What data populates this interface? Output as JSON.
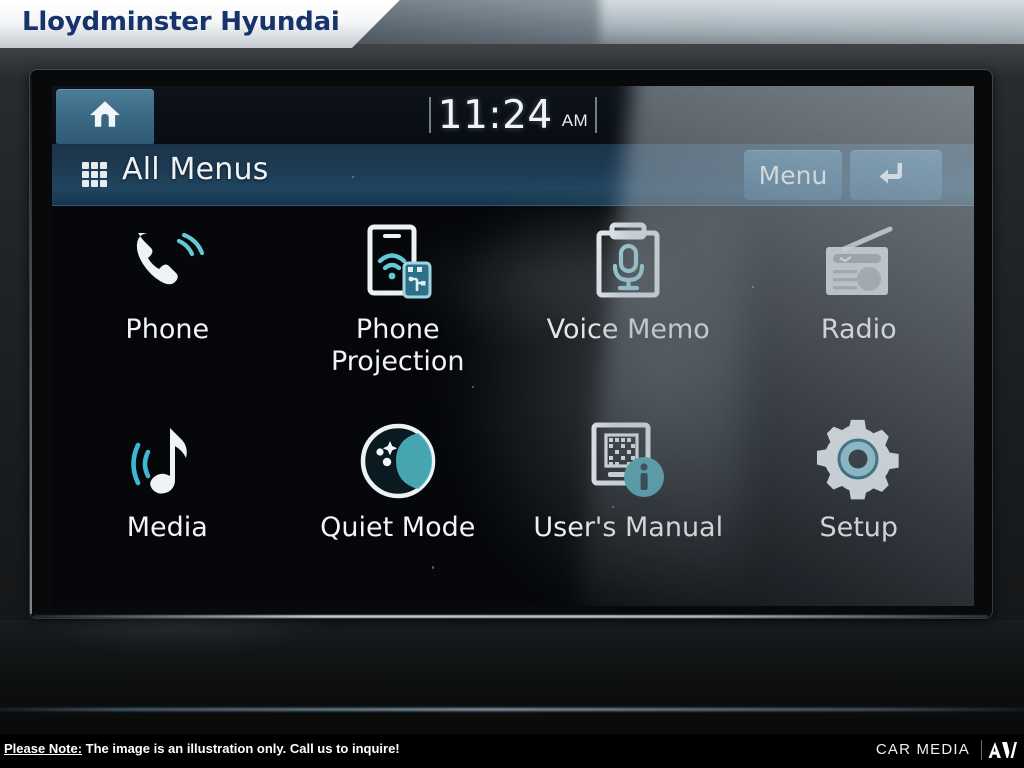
{
  "banner": {
    "dealer_name": "Lloydminster Hyundai"
  },
  "screen": {
    "statusbar": {
      "home_button": "home-icon",
      "clock_time": "11:24",
      "clock_period": "AM"
    },
    "titlebar": {
      "grid_icon": "grid-menu-icon",
      "title": "All Menus",
      "menu_button": "Menu",
      "back_button": "back-arrow-icon"
    },
    "apps": [
      {
        "label": "Phone",
        "icon": "phone-handset-icon"
      },
      {
        "label": "Phone\nProjection",
        "label_line1": "Phone",
        "label_line2": "Projection",
        "icon": "phone-projection-icon"
      },
      {
        "label": "Voice Memo",
        "icon": "voice-memo-icon"
      },
      {
        "label": "Radio",
        "icon": "radio-icon"
      },
      {
        "label": "Media",
        "icon": "music-note-icon"
      },
      {
        "label": "Quiet Mode",
        "icon": "crescent-moon-icon"
      },
      {
        "label": "User's Manual",
        "icon": "qr-manual-info-icon"
      },
      {
        "label": "Setup",
        "icon": "gear-icon"
      }
    ]
  },
  "footer": {
    "note_prefix": "Please Note:",
    "note_text": "The image is an illustration only. Call us to inquire!",
    "brand": "CAR MEDIA",
    "brand_mark": "av-logo-icon"
  },
  "colors": {
    "brand_blue": "#16336b",
    "accent_cyan": "#5fc3d6",
    "button_blue": "#35678a",
    "titlebar_blue": "#1d3b54",
    "icon_white": "#eef2f5"
  }
}
